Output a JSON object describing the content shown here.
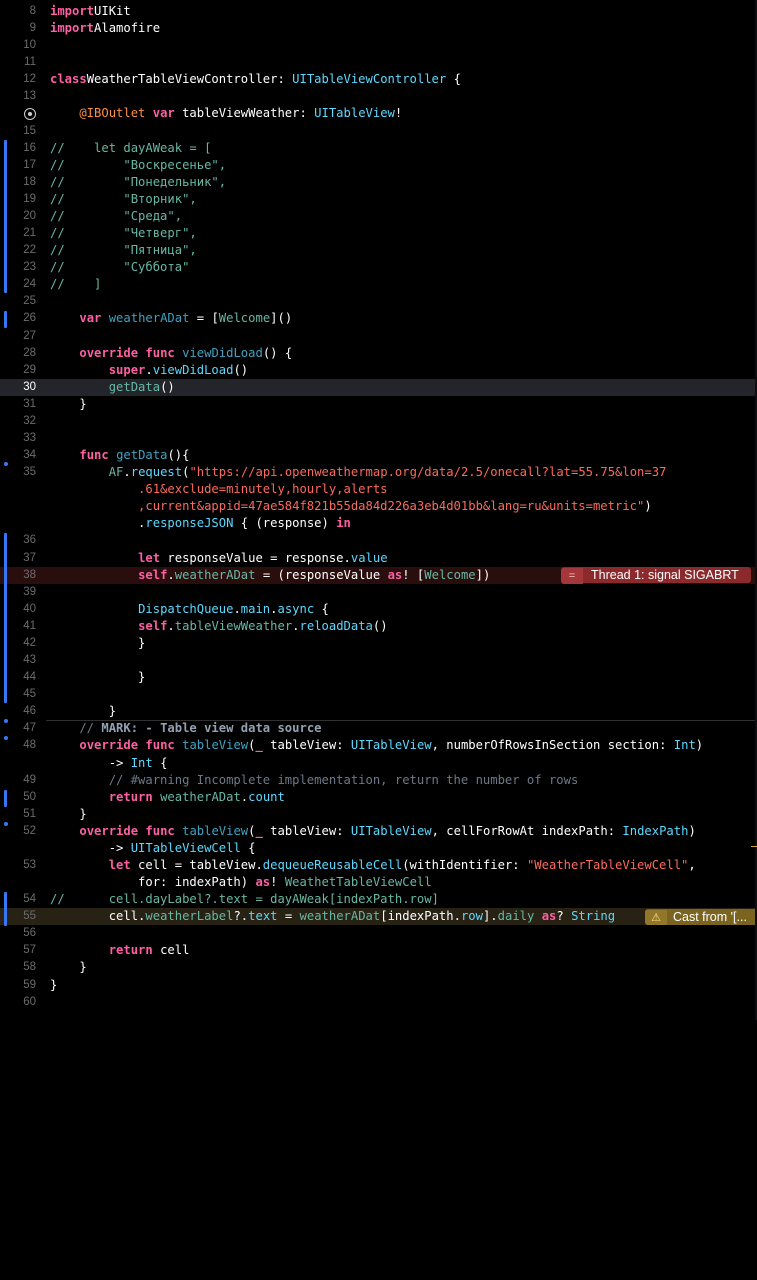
{
  "editor": {
    "lines": [
      {
        "num": "8",
        "tokens": [
          [
            "kw",
            "import"
          ],
          [
            "",
            "UIKit"
          ]
        ]
      },
      {
        "num": "9",
        "tokens": [
          [
            "kw",
            "import"
          ],
          [
            "",
            "Alamofire"
          ]
        ]
      },
      {
        "num": "10",
        "tokens": []
      },
      {
        "num": "11",
        "tokens": []
      },
      {
        "num": "12",
        "tokens": [
          [
            "kw",
            "class"
          ],
          [
            "",
            "WeatherTableViewController: "
          ],
          [
            "type",
            "UITableViewController"
          ],
          [
            "",
            " {"
          ]
        ]
      },
      {
        "num": "13",
        "tokens": []
      },
      {
        "num": "",
        "tokens": [
          [
            "attr",
            "    @IBOutlet"
          ],
          [
            "",
            " "
          ],
          [
            "kw",
            "var"
          ],
          [
            "",
            " tableViewWeather: "
          ],
          [
            "type",
            "UITableView"
          ],
          [
            "",
            "!"
          ]
        ]
      },
      {
        "num": "15",
        "tokens": []
      },
      {
        "num": "16",
        "tokens": [
          [
            "green",
            "//    let dayAWeak = ["
          ]
        ]
      },
      {
        "num": "17",
        "tokens": [
          [
            "green",
            "//        \"Воскресенье\","
          ]
        ]
      },
      {
        "num": "18",
        "tokens": [
          [
            "green",
            "//        \"Понедельник\","
          ]
        ]
      },
      {
        "num": "19",
        "tokens": [
          [
            "green",
            "//        \"Вторник\","
          ]
        ]
      },
      {
        "num": "20",
        "tokens": [
          [
            "green",
            "//        \"Среда\","
          ]
        ]
      },
      {
        "num": "21",
        "tokens": [
          [
            "green",
            "//        \"Четверг\","
          ]
        ]
      },
      {
        "num": "22",
        "tokens": [
          [
            "green",
            "//        \"Пятница\","
          ]
        ]
      },
      {
        "num": "23",
        "tokens": [
          [
            "green",
            "//        \"Суббота\""
          ]
        ]
      },
      {
        "num": "24",
        "tokens": [
          [
            "green",
            "//    ]"
          ]
        ]
      },
      {
        "num": "25",
        "tokens": []
      },
      {
        "num": "26",
        "tokens": [
          [
            "",
            "    "
          ],
          [
            "kw",
            "var"
          ],
          [
            "",
            " "
          ],
          [
            "fn",
            "weatherADat"
          ],
          [
            "",
            " = ["
          ],
          [
            "proj",
            "Welcome"
          ],
          [
            "",
            "]()"
          ]
        ]
      },
      {
        "num": "27",
        "tokens": []
      },
      {
        "num": "28",
        "tokens": [
          [
            "",
            "    "
          ],
          [
            "kw",
            "override"
          ],
          [
            "",
            " "
          ],
          [
            "kw",
            "func"
          ],
          [
            "",
            " "
          ],
          [
            "fn",
            "viewDidLoad"
          ],
          [
            "",
            "() {"
          ]
        ]
      },
      {
        "num": "29",
        "tokens": [
          [
            "",
            "        "
          ],
          [
            "kw",
            "super"
          ],
          [
            "",
            "."
          ],
          [
            "type",
            "viewDidLoad"
          ],
          [
            "",
            "()"
          ]
        ]
      },
      {
        "num": "30",
        "tokens": [
          [
            "",
            "        "
          ],
          [
            "proj",
            "getData"
          ],
          [
            "",
            "()"
          ]
        ]
      },
      {
        "num": "31",
        "tokens": [
          [
            "",
            "    }"
          ]
        ]
      },
      {
        "num": "32",
        "tokens": []
      },
      {
        "num": "33",
        "tokens": []
      },
      {
        "num": "34",
        "tokens": [
          [
            "",
            "    "
          ],
          [
            "kw",
            "func"
          ],
          [
            "",
            " "
          ],
          [
            "fn",
            "getData"
          ],
          [
            "",
            "(){"
          ]
        ]
      },
      {
        "num": "35",
        "tokens": [
          [
            "",
            "        "
          ],
          [
            "proj",
            "AF"
          ],
          [
            "",
            "."
          ],
          [
            "type",
            "request"
          ],
          [
            "",
            "("
          ],
          [
            "str",
            "\"https://api.openweathermap.org/data/2.5/onecall?lat=55.75&lon=37"
          ]
        ]
      },
      {
        "num": "",
        "tokens": [
          [
            "str",
            "            .61&exclude=minutely,hourly,alerts"
          ]
        ]
      },
      {
        "num": "",
        "tokens": [
          [
            "str",
            "            ,current&appid=47ae584f821b55da84d226a3eb4d01bb&lang=ru&units=metric\""
          ],
          [
            "",
            ")"
          ]
        ]
      },
      {
        "num": "",
        "tokens": [
          [
            "",
            "            ."
          ],
          [
            "type",
            "responseJSON"
          ],
          [
            "",
            " { (response) "
          ],
          [
            "kw",
            "in"
          ]
        ]
      },
      {
        "num": "36",
        "tokens": []
      },
      {
        "num": "37",
        "tokens": [
          [
            "",
            "            "
          ],
          [
            "kw",
            "let"
          ],
          [
            "",
            " responseValue = response."
          ],
          [
            "type",
            "value"
          ]
        ]
      },
      {
        "num": "38",
        "tokens": [
          [
            "",
            "            "
          ],
          [
            "kw",
            "self"
          ],
          [
            "",
            "."
          ],
          [
            "proj",
            "weatherADat"
          ],
          [
            "",
            " = (responseValue "
          ],
          [
            "kw",
            "as"
          ],
          [
            "",
            "! ["
          ],
          [
            "proj",
            "Welcome"
          ],
          [
            "",
            "])"
          ]
        ]
      },
      {
        "num": "39",
        "tokens": []
      },
      {
        "num": "40",
        "tokens": [
          [
            "",
            "            "
          ],
          [
            "type",
            "DispatchQueue"
          ],
          [
            "",
            "."
          ],
          [
            "type",
            "main"
          ],
          [
            "",
            "."
          ],
          [
            "type",
            "async"
          ],
          [
            "",
            " {"
          ]
        ]
      },
      {
        "num": "41",
        "tokens": [
          [
            "",
            "            "
          ],
          [
            "kw",
            "self"
          ],
          [
            "",
            "."
          ],
          [
            "proj",
            "tableViewWeather"
          ],
          [
            "",
            "."
          ],
          [
            "type",
            "reloadData"
          ],
          [
            "",
            "()"
          ]
        ]
      },
      {
        "num": "42",
        "tokens": [
          [
            "",
            "            }"
          ]
        ]
      },
      {
        "num": "43",
        "tokens": []
      },
      {
        "num": "44",
        "tokens": [
          [
            "",
            "            }"
          ]
        ]
      },
      {
        "num": "45",
        "tokens": []
      },
      {
        "num": "46",
        "tokens": [
          [
            "",
            "        }"
          ]
        ]
      },
      {
        "num": "47",
        "tokens": [
          [
            "cmt",
            "    // "
          ],
          [
            "mark",
            "MARK: - Table view data source"
          ]
        ]
      },
      {
        "num": "48",
        "tokens": [
          [
            "",
            "    "
          ],
          [
            "kw",
            "override"
          ],
          [
            "",
            " "
          ],
          [
            "kw",
            "func"
          ],
          [
            "",
            " "
          ],
          [
            "fn",
            "tableView"
          ],
          [
            "",
            "("
          ],
          [
            "kw",
            "_"
          ],
          [
            "",
            " tableView: "
          ],
          [
            "type",
            "UITableView"
          ],
          [
            "",
            ", numberOfRowsInSection section: "
          ],
          [
            "type",
            "Int"
          ],
          [
            "",
            ")"
          ]
        ]
      },
      {
        "num": "",
        "tokens": [
          [
            "",
            "        -> "
          ],
          [
            "type",
            "Int"
          ],
          [
            "",
            " {"
          ]
        ]
      },
      {
        "num": "49",
        "tokens": [
          [
            "cmt",
            "        // #warning Incomplete implementation, return the number of rows"
          ]
        ]
      },
      {
        "num": "50",
        "tokens": [
          [
            "",
            "        "
          ],
          [
            "kw",
            "return"
          ],
          [
            "",
            " "
          ],
          [
            "proj",
            "weatherADat"
          ],
          [
            "",
            "."
          ],
          [
            "type",
            "count"
          ]
        ]
      },
      {
        "num": "51",
        "tokens": [
          [
            "",
            "    }"
          ]
        ]
      },
      {
        "num": "52",
        "tokens": [
          [
            "",
            "    "
          ],
          [
            "kw",
            "override"
          ],
          [
            "",
            " "
          ],
          [
            "kw",
            "func"
          ],
          [
            "",
            " "
          ],
          [
            "fn",
            "tableView"
          ],
          [
            "",
            "("
          ],
          [
            "kw",
            "_"
          ],
          [
            "",
            " tableView: "
          ],
          [
            "type",
            "UITableView"
          ],
          [
            "",
            ", cellForRowAt indexPath: "
          ],
          [
            "type",
            "IndexPath"
          ],
          [
            "",
            ")"
          ]
        ]
      },
      {
        "num": "",
        "tokens": [
          [
            "",
            "        -> "
          ],
          [
            "type",
            "UITableViewCell"
          ],
          [
            "",
            " {"
          ]
        ]
      },
      {
        "num": "53",
        "tokens": [
          [
            "",
            "        "
          ],
          [
            "kw",
            "let"
          ],
          [
            "",
            " cell = tableView."
          ],
          [
            "type",
            "dequeueReusableCell"
          ],
          [
            "",
            "(withIdentifier: "
          ],
          [
            "str",
            "\"WeatherTableViewCell\""
          ],
          [
            "",
            ","
          ]
        ]
      },
      {
        "num": "",
        "tokens": [
          [
            "",
            "            for: indexPath) "
          ],
          [
            "kw",
            "as"
          ],
          [
            "",
            "! "
          ],
          [
            "proj",
            "WeathetTableViewCell"
          ]
        ]
      },
      {
        "num": "54",
        "tokens": [
          [
            "green",
            "//      cell.dayLabel?.text = dayAWeak[indexPath.row]"
          ]
        ]
      },
      {
        "num": "55",
        "tokens": [
          [
            "",
            "        cell."
          ],
          [
            "proj",
            "weatherLabel"
          ],
          [
            "",
            "?."
          ],
          [
            "type",
            "text"
          ],
          [
            "",
            " = "
          ],
          [
            "proj",
            "weatherADat"
          ],
          [
            "",
            "[indexPath."
          ],
          [
            "type",
            "row"
          ],
          [
            "",
            "]."
          ],
          [
            "proj",
            "daily"
          ],
          [
            "",
            " "
          ],
          [
            "kw",
            "as"
          ],
          [
            "",
            "? "
          ],
          [
            "type",
            "String"
          ]
        ]
      },
      {
        "num": "56",
        "tokens": []
      },
      {
        "num": "57",
        "tokens": [
          [
            "",
            "        "
          ],
          [
            "kw",
            "return"
          ],
          [
            "",
            " cell"
          ]
        ]
      },
      {
        "num": "58",
        "tokens": [
          [
            "",
            "    }"
          ]
        ]
      },
      {
        "num": "59",
        "tokens": [
          [
            "",
            "}"
          ]
        ]
      },
      {
        "num": "60",
        "tokens": []
      }
    ],
    "current_line": "30",
    "error_badge": {
      "icon": "=",
      "message": "Thread 1: signal SIGABRT"
    },
    "warning_badge": {
      "icon": "⚠",
      "message": "Cast from '[..."
    }
  },
  "colors": {
    "background": "#000000",
    "keyword": "#fc5fa3",
    "type": "#5dd8ff",
    "project_symbol": "#67b7a4",
    "string": "#fc6a5d",
    "comment": "#6c7986",
    "error": "#8b2a2d",
    "warning": "#7a6420",
    "change_bar": "#3478f6"
  }
}
